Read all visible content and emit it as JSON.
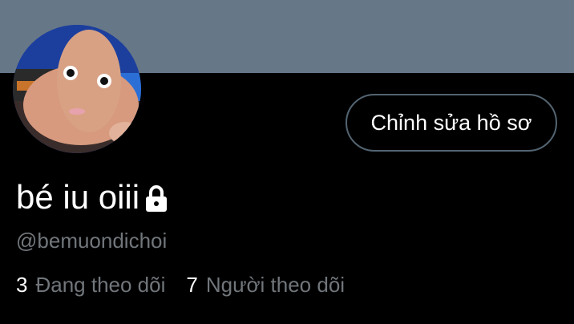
{
  "profile": {
    "display_name": "bé iu oiii",
    "handle": "@bemuondichoi",
    "locked_icon": "lock-icon",
    "edit_button_label": "Chỉnh sửa hồ sơ"
  },
  "stats": {
    "following_count": "3",
    "following_label": "Đang theo dõi",
    "followers_count": "7",
    "followers_label": "Người theo dõi"
  },
  "colors": {
    "banner": "#667788",
    "background": "#000000",
    "secondary_text": "#71767b",
    "button_border": "#536471"
  }
}
